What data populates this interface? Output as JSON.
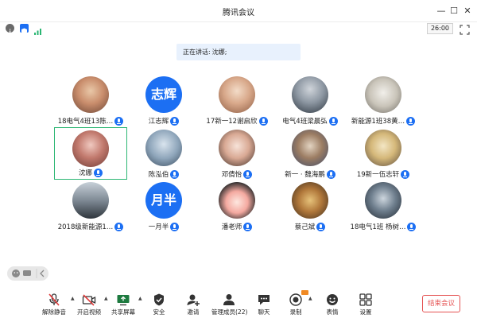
{
  "window": {
    "title": "腾讯会议",
    "minimize": "—",
    "maximize": "☐",
    "close": "✕"
  },
  "infobar": {
    "timer": "26:00"
  },
  "speaking": {
    "label": "正在讲话:",
    "speaker": "沈娜;"
  },
  "participants": [
    {
      "name": "18电气4班13陈…",
      "avatar_type": "photo"
    },
    {
      "name": "江志辉",
      "avatar_type": "text",
      "avatar_text": "志辉"
    },
    {
      "name": "17新一12谢启欣",
      "avatar_type": "photo"
    },
    {
      "name": "电气4班梁晨弘",
      "avatar_type": "photo"
    },
    {
      "name": "新能源1班38黄…",
      "avatar_type": "photo"
    },
    {
      "name": "沈娜",
      "avatar_type": "photo",
      "active": true
    },
    {
      "name": "陈泓伯",
      "avatar_type": "photo"
    },
    {
      "name": "邓倩怡",
      "avatar_type": "photo"
    },
    {
      "name": "新一 · 魏海鹏",
      "avatar_type": "photo"
    },
    {
      "name": "19新一伍志轩",
      "avatar_type": "photo"
    },
    {
      "name": "2018级新能源1…",
      "avatar_type": "photo"
    },
    {
      "name": "一月半",
      "avatar_type": "text",
      "avatar_text": "月半"
    },
    {
      "name": "潘老师",
      "avatar_type": "photo"
    },
    {
      "name": "蔡己斌",
      "avatar_type": "photo"
    },
    {
      "name": "18电气1班 杨树…",
      "avatar_type": "photo"
    }
  ],
  "toolbar": {
    "unmute": "解除静音",
    "video": "开启视频",
    "share": "共享屏幕",
    "security": "安全",
    "invite": "邀请",
    "members": "管理成员(22)",
    "chat": "聊天",
    "record": "录制",
    "reactions": "表情",
    "settings": "设置",
    "end": "结束会议"
  },
  "colors": {
    "accent": "#1c6ff3",
    "active_border": "#2bb673",
    "end_red": "#e55353",
    "mute_red": "#e03b3b"
  }
}
